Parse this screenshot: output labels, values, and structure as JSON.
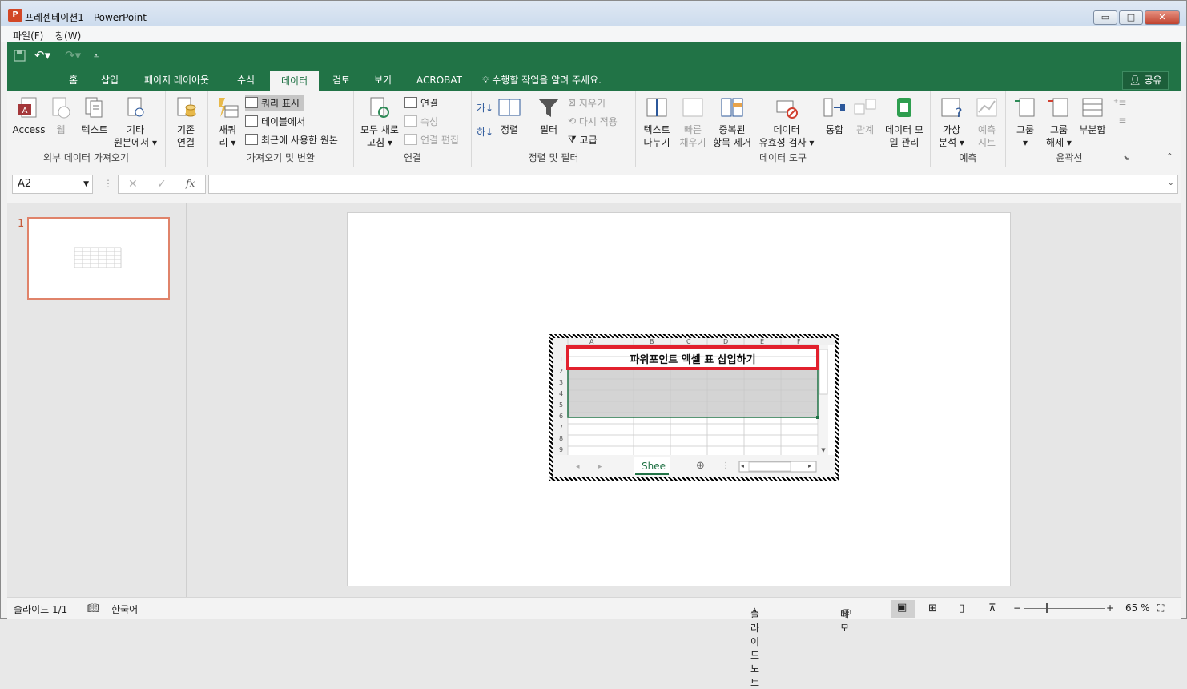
{
  "window": {
    "title": "프레젠테이션1 - PowerPoint",
    "app_icon": "P",
    "minimize": "▭",
    "maximize": "□",
    "close": "✕"
  },
  "menu": {
    "file": "파일(F)",
    "window": "창(W)"
  },
  "tabs": [
    "홈",
    "삽입",
    "페이지 레이아웃",
    "수식",
    "데이터",
    "검토",
    "보기",
    "ACROBAT"
  ],
  "active_tab": "데이터",
  "tell_me": "수행할 작업을 알려 주세요.",
  "share": "공유",
  "ribbon": {
    "g1": {
      "label": "외부 데이터 가져오기",
      "access": "Access",
      "web": "웹",
      "text": "텍스트",
      "other1": "기타",
      "other2": "원본에서 ▾",
      "existing1": "기존",
      "existing2": "연결"
    },
    "g2": {
      "label": "가져오기 및 변환",
      "newq1": "새쿼",
      "newq2": "리 ▾",
      "show": "쿼리 표시",
      "fromtable": "테이블에서",
      "recent": "최근에 사용한 원본"
    },
    "g3": {
      "label": "연결",
      "refresh1": "모두 새로",
      "refresh2": "고침 ▾",
      "conn": "연결",
      "props": "속성",
      "edit": "연결 편집"
    },
    "g4": {
      "label": "정렬 및 필터",
      "sort": "정렬",
      "filter": "필터",
      "clear": "지우기",
      "reapply": "다시 적용",
      "adv": "고급",
      "az": "가↓",
      "za": "하↓"
    },
    "g5": {
      "label": "데이터 도구",
      "t2c1": "텍스트",
      "t2c2": "나누기",
      "flash1": "빠른",
      "flash2": "채우기",
      "dup1": "중복된",
      "dup2": "항목 제거",
      "val1": "데이터",
      "val2": "유효성 검사 ▾",
      "cons": "통합",
      "rel": "관계",
      "model1": "데이터 모",
      "model2": "델 관리"
    },
    "g6": {
      "label": "예측",
      "whatif1": "가상",
      "whatif2": "분석 ▾",
      "fc1": "예측",
      "fc2": "시트"
    },
    "g7": {
      "label": "윤곽선",
      "group1": "그룹",
      "group2": "▾",
      "ungroup1": "그룹",
      "ungroup2": "해제 ▾",
      "subtotal": "부분합"
    }
  },
  "formula_bar": {
    "name_box": "A2",
    "cancel": "✕",
    "enter": "✓",
    "fx": "fx",
    "value": ""
  },
  "thumb_number": "1",
  "sheet": {
    "columns": [
      "A",
      "B",
      "C",
      "D",
      "E",
      "F"
    ],
    "rows": [
      "1",
      "2",
      "3",
      "4",
      "5",
      "6",
      "7",
      "8",
      "9"
    ],
    "title_text": "파워포인트 엑셀 표 삽입하기",
    "tab_name": "Shee"
  },
  "status": {
    "slide": "슬라이드 1/1",
    "lang": "한국어",
    "notes": "슬라이드 노트",
    "comments": "메모",
    "zoom": "65 %",
    "minus": "−",
    "plus": "+"
  },
  "colors": {
    "accent": "#217346",
    "highlight": "#e2202d",
    "thumb_border": "#e0836a"
  }
}
